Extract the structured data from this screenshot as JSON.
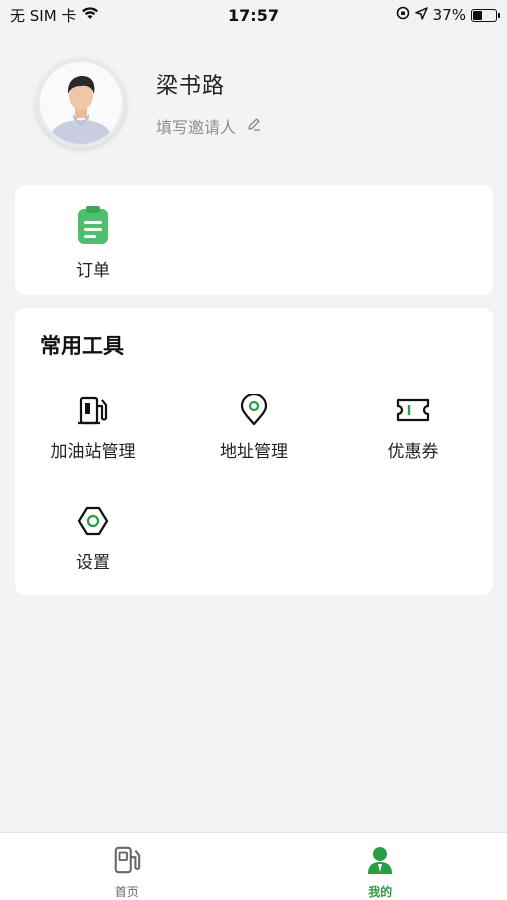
{
  "status_bar": {
    "carrier": "无 SIM 卡",
    "time": "17:57",
    "battery_percent": "37%",
    "battery_level": 0.37
  },
  "profile": {
    "name": "梁书路",
    "invite_text": "填写邀请人"
  },
  "orders_card": {
    "items": [
      {
        "label": "订单",
        "icon": "clipboard-icon"
      }
    ]
  },
  "tools": {
    "title": "常用工具",
    "items": [
      {
        "label": "加油站管理",
        "icon": "gas-station-icon"
      },
      {
        "label": "地址管理",
        "icon": "location-pin-icon"
      },
      {
        "label": "优惠券",
        "icon": "coupon-icon"
      },
      {
        "label": "设置",
        "icon": "gear-icon"
      }
    ]
  },
  "tab_bar": {
    "tabs": [
      {
        "label": "首页",
        "icon": "gas-station-icon",
        "active": false
      },
      {
        "label": "我的",
        "icon": "user-icon",
        "active": true
      }
    ],
    "active_color": "#2a9d45"
  },
  "colors": {
    "accent": "#2a9d45",
    "order_icon": "#4fbf6e"
  }
}
